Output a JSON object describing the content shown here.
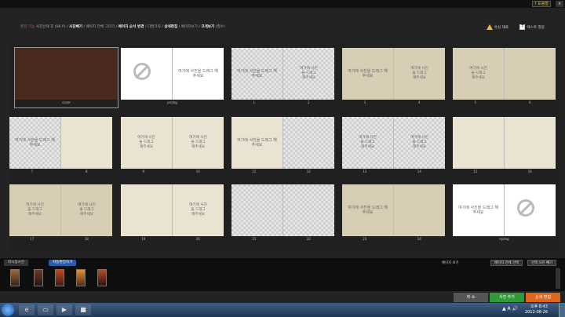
{
  "titlebar": {
    "help_label": "? 도움말",
    "close_label": "x"
  },
  "steps": {
    "current": "편집 기능",
    "s1": "사진선택 후 (86 P)",
    "s2": "사진빼기",
    "s3": "페이지 전체 그리기",
    "s4": "페이지 순서 변경",
    "s5": "다봤크릭",
    "s6": "상세편집",
    "s7": "페이지보기",
    "s8": "크게보기",
    "s9": "(필수)"
  },
  "warnings": {
    "w1": "유실 재료",
    "w2": "텍스트 칠봉"
  },
  "placeholder": "여기에 사진을 드래그 해주세요",
  "pages": [
    {
      "left": "cover",
      "right": ""
    },
    {
      "left": "prolog",
      "right": ""
    },
    {
      "left": "1",
      "right": "2"
    },
    {
      "left": "3",
      "right": "4"
    },
    {
      "left": "5",
      "right": "6"
    },
    {
      "left": "7",
      "right": "8"
    },
    {
      "left": "9",
      "right": "10"
    },
    {
      "left": "11",
      "right": "12"
    },
    {
      "left": "13",
      "right": "14"
    },
    {
      "left": "15",
      "right": "16"
    },
    {
      "left": "17",
      "right": "18"
    },
    {
      "left": "19",
      "right": "20"
    },
    {
      "left": "21",
      "right": "22"
    },
    {
      "left": "23",
      "right": "24"
    },
    {
      "left": "epilog",
      "right": ""
    }
  ],
  "bottom": {
    "tab_all": "마시용사진",
    "tab_auto": "자동편집하기",
    "pager": "페이지 보기",
    "btn_all_select": "페이지 전체 선택",
    "btn_clear": "선택 사진 빼기"
  },
  "actions": {
    "cancel": "취 소",
    "add_photo": "사진 추가",
    "detail": "상세 편집"
  },
  "colors": {
    "cancel": "#555555",
    "add_photo": "#2f9a3a",
    "detail": "#e0661c"
  },
  "taskbar": {
    "time": "오후 8:43",
    "date": "2012-08-26",
    "icons": [
      "ie-icon",
      "folder-icon",
      "media-icon",
      "app-icon"
    ]
  }
}
